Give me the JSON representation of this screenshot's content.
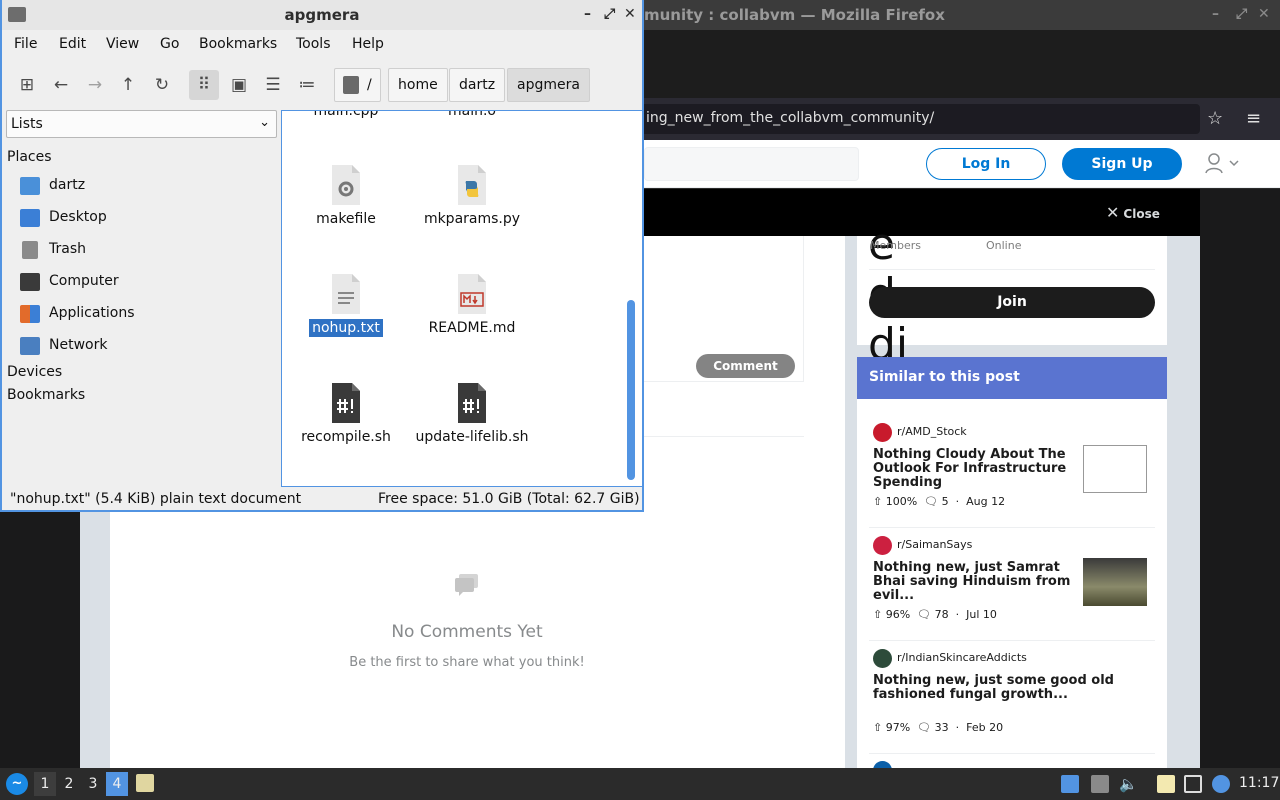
{
  "firefox": {
    "title": "munity : collabvm — Mozilla Firefox",
    "url": "ing_new_from_the_collabvm_community/"
  },
  "reddit": {
    "login": "Log In",
    "signup": "Sign Up",
    "close": "Close",
    "members_label": "Members",
    "online_label": "Online",
    "join": "Join",
    "comment_btn": "Comment",
    "no_comments_title": "No Comments Yet",
    "no_comments_sub": "Be the first to share what you think!",
    "big_letters": "e\nd\ndi",
    "similar_title": "Similar to this post",
    "similar": [
      {
        "sub": "r/AMD_Stock",
        "title": "Nothing Cloudy About The Outlook For Infrastructure Spending",
        "pct": "100%",
        "comments": "5",
        "date": "Aug 12",
        "color": "#c81a2c"
      },
      {
        "sub": "r/SaimanSays",
        "title": "Nothing new, just Samrat Bhai saving Hinduism from evil...",
        "pct": "96%",
        "comments": "78",
        "date": "Jul 10",
        "color": "#cc2040"
      },
      {
        "sub": "r/IndianSkincareAddicts",
        "title": "Nothing new, just some good old fashioned fungal growth...",
        "pct": "97%",
        "comments": "33",
        "date": "Feb 20",
        "color": "#2d4b3a"
      }
    ]
  },
  "fm": {
    "title": "apgmera",
    "menu": [
      "File",
      "Edit",
      "View",
      "Go",
      "Bookmarks",
      "Tools",
      "Help"
    ],
    "crumbs": [
      "/",
      "home",
      "dartz",
      "apgmera"
    ],
    "side_mode": "Lists",
    "places_header": "Places",
    "places": [
      {
        "label": "dartz",
        "icon": "home-folder-icon",
        "color": "#4a90d9"
      },
      {
        "label": "Desktop",
        "icon": "desktop-icon",
        "color": "#3b7fd6"
      },
      {
        "label": "Trash",
        "icon": "trash-icon",
        "color": "#8a8a8a"
      },
      {
        "label": "Computer",
        "icon": "computer-icon",
        "color": "#3a3a3a"
      },
      {
        "label": "Applications",
        "icon": "applications-icon",
        "color": "#e26b2b"
      },
      {
        "label": "Network",
        "icon": "network-icon",
        "color": "#4a7fc0"
      }
    ],
    "devices_header": "Devices",
    "bookmarks_header": "Bookmarks",
    "files_top": [
      "main.cpp",
      "main.o"
    ],
    "files": [
      {
        "name": "makefile",
        "icon": "makefile-icon"
      },
      {
        "name": "mkparams.py",
        "icon": "python-icon"
      },
      {
        "name": "nohup.txt",
        "icon": "text-file-icon",
        "selected": true
      },
      {
        "name": "README.md",
        "icon": "markdown-icon"
      },
      {
        "name": "recompile.sh",
        "icon": "script-icon"
      },
      {
        "name": "update-lifelib.sh",
        "icon": "script-icon"
      }
    ],
    "status_left": "\"nohup.txt\" (5.4 KiB) plain text document",
    "status_right": "Free space: 51.0 GiB (Total: 62.7 GiB)"
  },
  "taskbar": {
    "workspaces": [
      "1",
      "2",
      "3",
      "4"
    ],
    "active_workspace": "4",
    "clock": "11:17"
  }
}
